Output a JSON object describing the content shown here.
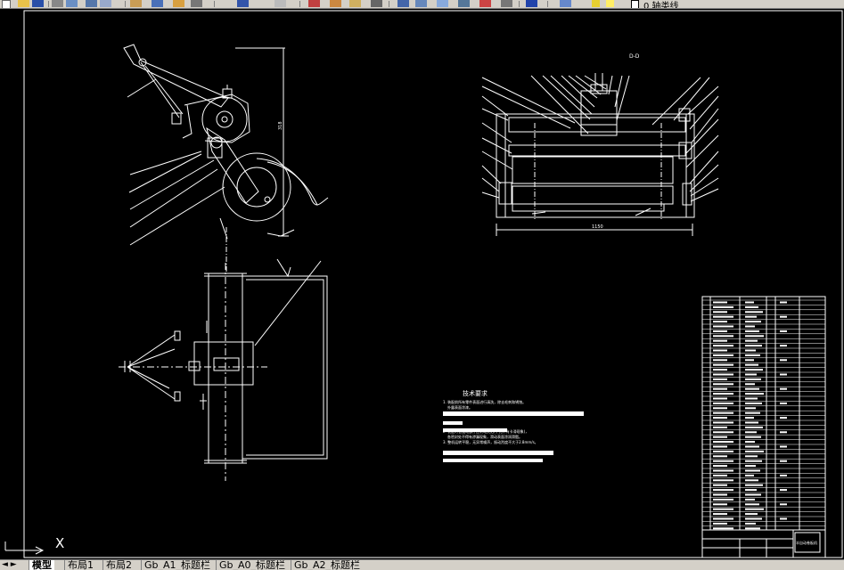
{
  "toolbar": {
    "layer_name": "0 轴类线",
    "icons": [
      "new-icon",
      "open-icon",
      "save-icon",
      "print-icon",
      "preview-icon",
      "cut-icon",
      "copy-icon",
      "paste-icon",
      "match-icon",
      "undo-icon",
      "redo-icon",
      "pan-icon",
      "zoom-icon",
      "zoom-window-icon",
      "zoom-previous-icon",
      "properties-icon",
      "design-center-icon",
      "tool-palette-icon",
      "sheet-set-icon",
      "markup-icon",
      "calculator-icon",
      "help-icon",
      "layer-icon",
      "layer-state-icon",
      "bulb-icon",
      "sun-icon",
      "lock-icon",
      "color-icon"
    ]
  },
  "drawing": {
    "section_label": "D-D",
    "tech_req_title": "技术要求",
    "tech_req_lines": [
      "1. 装配前所有零件表面进行清洗，除去毛刺和锈蚀。",
      "外露表面涂漆。",
      "2. 装配时各运动部件应转动灵活(不允许有卡滞现象)，",
      "各密封处不得有渗漏现象，滑动表面涂润滑脂。",
      "3. 整机运转平稳，无异常噪声，振动烈度不大于2.8mm/s。"
    ],
    "dim_bottom": "1150",
    "dim_vertical": "318",
    "title_block_name": "半自动卷板机",
    "crosshair_label": "X"
  },
  "tabs": {
    "nav": "◄ ►",
    "items": [
      "模型",
      "布局1",
      "布局2",
      "Gb_A1_标题栏",
      "Gb_A0_标题栏",
      "Gb_A2_标题栏"
    ],
    "active_index": 0
  }
}
